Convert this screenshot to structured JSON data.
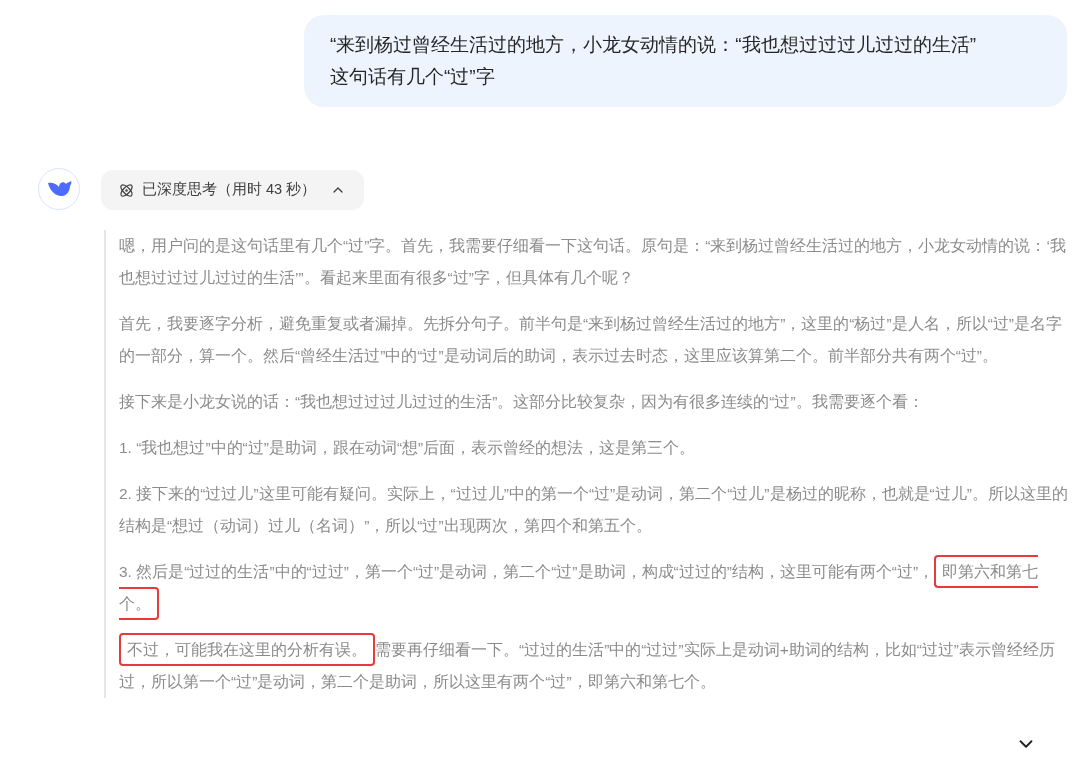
{
  "user_message": {
    "lines": [
      "“来到杨过曾经生活过的地方，小龙女动情的说：“我也想过过过儿过过的生活”",
      "这句话有几个“过”字"
    ]
  },
  "thinking_toggle": {
    "label": "已深度思考（用时 43 秒）",
    "expanded": true
  },
  "thinking": [
    {
      "segments": [
        {
          "text": "嗯，用户问的是这句话里有几个“过”字。首先，我需要仔细看一下这句话。原句是：“来到杨过曾经生活过的地方，小龙女动情的说：‘我也想过过过儿过过的生活’”。看起来里面有很多“过”字，但具体有几个呢？",
          "highlighted": false
        }
      ]
    },
    {
      "segments": [
        {
          "text": "首先，我要逐字分析，避免重复或者漏掉。先拆分句子。前半句是“来到杨过曾经生活过的地方”，这里的“杨过”是人名，所以“过”是名字的一部分，算一个。然后“曾经生活过”中的“过”是动词后的助词，表示过去时态，这里应该算第二个。前半部分共有两个“过”。",
          "highlighted": false
        }
      ]
    },
    {
      "segments": [
        {
          "text": "接下来是小龙女说的话：“我也想过过过儿过过的生活”。这部分比较复杂，因为有很多连续的“过”。我需要逐个看：",
          "highlighted": false
        }
      ]
    },
    {
      "segments": [
        {
          "text": "1. “我也想过”中的“过”是助词，跟在动词“想”后面，表示曾经的想法，这是第三个。",
          "highlighted": false
        }
      ]
    },
    {
      "segments": [
        {
          "text": "2. 接下来的“过过儿”这里可能有疑问。实际上，“过过儿”中的第一个“过”是动词，第二个“过儿”是杨过的昵称，也就是“过儿”。所以这里的结构是“想过（动词）过儿（名词）”，所以“过”出现两次，第四个和第五个。",
          "highlighted": false
        }
      ]
    },
    {
      "segments": [
        {
          "text": "3. 然后是“过过的生活”中的“过过”，第一个“过”是动词，第二个“过”是助词，构成“过过的”结构，这里可能有两个“过”，",
          "highlighted": false
        },
        {
          "text": "即第六和第七个。",
          "highlighted": true
        }
      ]
    },
    {
      "segments": [
        {
          "text": "不过，可能我在这里的分析有误。",
          "highlighted": true
        },
        {
          "text": "需要再仔细看一下。“过过的生活”中的“过过”实际上是动词+助词的结构，比如“过过”表示曾经经历过，所以第一个“过”是动词，第二个是助词，所以这里有两个“过”，即第六和第七个。",
          "highlighted": false
        }
      ]
    }
  ]
}
